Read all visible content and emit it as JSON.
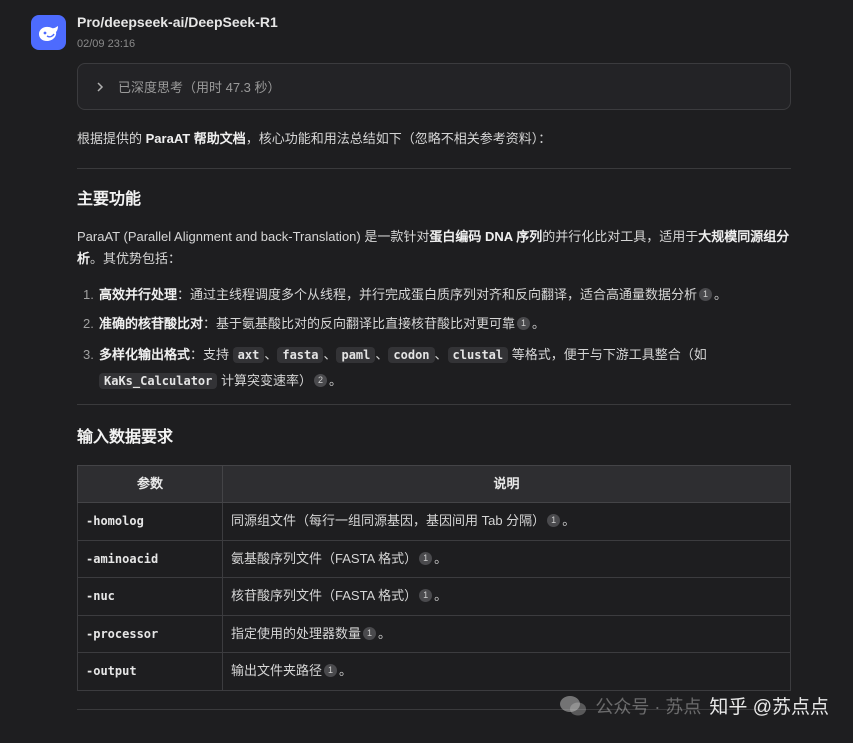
{
  "header": {
    "name": "Pro/deepseek-ai/DeepSeek-R1",
    "time": "02/09 23:16"
  },
  "thinking": {
    "label": "已深度思考（用时 47.3 秒）"
  },
  "intro": {
    "p1": "根据提供的 ",
    "bold": "ParaAT 帮助文档",
    "p2": "，核心功能和用法总结如下（忽略不相关参考资料）："
  },
  "section1": {
    "title": "主要功能",
    "desc_p1": "ParaAT (Parallel Alignment and back-Translation) 是一款针对",
    "desc_b1": "蛋白编码 DNA 序列",
    "desc_p2": "的并行化比对工具，适用于",
    "desc_b2": "大规模同源组分析",
    "desc_p3": "。其优势包括：",
    "items": [
      {
        "num": "1.",
        "bold": "高效并行处理",
        "text": "：通过主线程调度多个从线程，并行完成蛋白质序列对齐和反向翻译，适合高通量数据分析",
        "ref": "1",
        "end": "。"
      },
      {
        "num": "2.",
        "bold": "准确的核苷酸比对",
        "text": "：基于氨基酸比对的反向翻译比直接核苷酸比对更可靠",
        "ref": "1",
        "end": "。"
      }
    ],
    "item3": {
      "num": "3.",
      "bold": "多样化输出格式",
      "text1": "：支持 ",
      "codes": [
        "axt",
        "fasta",
        "paml",
        "codon",
        "clustal"
      ],
      "sep": "、",
      "text2": " 等格式，便于与下游工具整合（如 ",
      "code_tool": "KaKs_Calculator",
      "text3": " 计算突变速率）",
      "ref": "2",
      "end": "。"
    }
  },
  "section2": {
    "title": "输入数据要求",
    "columns": [
      "参数",
      "说明"
    ],
    "rows": [
      {
        "param": "-homolog",
        "desc": "同源组文件（每行一组同源基因，基因间用 Tab 分隔）",
        "ref": "1",
        "end": "。"
      },
      {
        "param": "-aminoacid",
        "desc": "氨基酸序列文件（FASTA 格式）",
        "ref": "1",
        "end": "。"
      },
      {
        "param": "-nuc",
        "desc": "核苷酸序列文件（FASTA 格式）",
        "ref": "1",
        "end": "。"
      },
      {
        "param": "-processor",
        "desc": "指定使用的处理器数量",
        "ref": "1",
        "end": "。"
      },
      {
        "param": "-output",
        "desc": "输出文件夹路径",
        "ref": "1",
        "end": "。"
      }
    ]
  },
  "watermark": {
    "faint": "公众号 · 苏点",
    "main": "知乎 @苏点点"
  },
  "colors": {
    "background": "#1e1e20",
    "avatar": "#4d6bfe"
  }
}
